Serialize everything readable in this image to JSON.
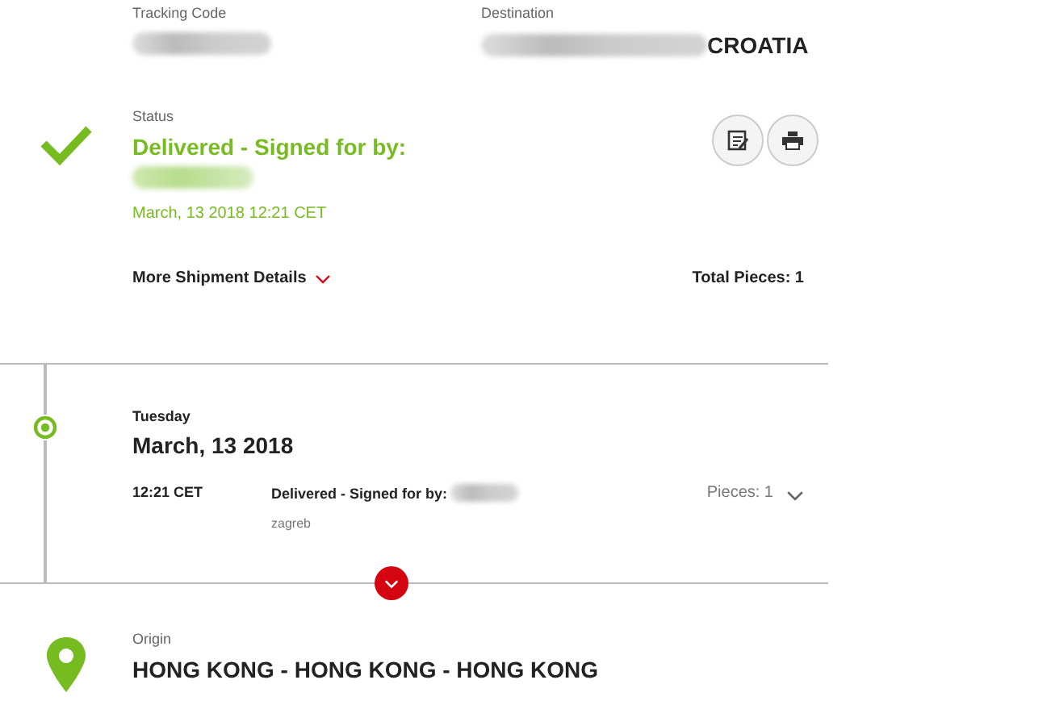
{
  "tracking": {
    "label": "Tracking Code"
  },
  "destination": {
    "label": "Destination",
    "value": "CROATIA"
  },
  "status": {
    "label": "Status",
    "headline": "Delivered - Signed for by:",
    "date": "March, 13 2018 12:21 CET",
    "more_details": "More Shipment Details",
    "total_pieces": "Total Pieces: 1"
  },
  "events": [
    {
      "weekday": "Tuesday",
      "date": "March, 13 2018",
      "entries": [
        {
          "time": "12:21 CET",
          "description": "Delivered - Signed for by:",
          "location": "zagreb",
          "pieces": "Pieces: 1",
          "expanded": false
        }
      ]
    }
  ],
  "origin": {
    "label": "Origin",
    "value": "HONG KONG - HONG KONG - HONG KONG"
  }
}
